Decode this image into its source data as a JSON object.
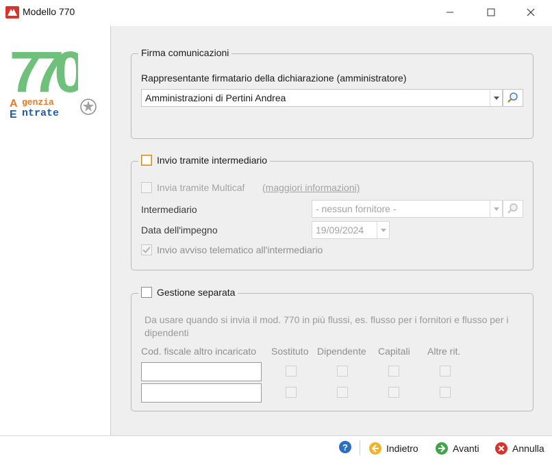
{
  "window": {
    "title": "Modello 770",
    "minimize_icon": "minimize-icon",
    "maximize_icon": "maximize-icon",
    "close_icon": "close-icon"
  },
  "sidebar": {
    "logo_number": "770",
    "agency_line1": "genzia",
    "agency_line2": "ntrate"
  },
  "firma": {
    "legend": "Firma comunicazioni",
    "field_label": "Rappresentante firmatario della dichiarazione (amministratore)",
    "selected_value": "Amministrazioni di Pertini Andrea"
  },
  "intermediario": {
    "legend": "Invio tramite intermediario",
    "checked": false,
    "multicaf_label": "Invia tramite Multicaf",
    "multicaf_link": "(maggiori informazioni)",
    "intermediario_label": "Intermediario",
    "intermediario_value": "- nessun fornitore -",
    "data_label": "Data dell'impegno",
    "data_value": "19/09/2024",
    "avviso_label": "Invio avviso telematico all'intermediario",
    "avviso_checked": true
  },
  "gestione": {
    "legend": "Gestione separata",
    "checked": false,
    "note": "Da usare quando si invia il mod. 770 in più flussi, es. flusso per i fornitori e flusso per i dipendenti",
    "columns": [
      "Cod. fiscale altro incaricato",
      "Sostituto",
      "Dipendente",
      "Capitali",
      "Altre rit."
    ],
    "rows": [
      {
        "cod_fiscale": "",
        "sostituto": false,
        "dipendente": false,
        "capitali": false,
        "altre": false
      },
      {
        "cod_fiscale": "",
        "sostituto": false,
        "dipendente": false,
        "capitali": false,
        "altre": false
      }
    ]
  },
  "footer": {
    "help_icon": "help-icon",
    "back_label": "Indietro",
    "next_label": "Avanti",
    "cancel_label": "Annulla"
  },
  "colors": {
    "logo_green": "#6ec07a",
    "agency_orange": "#e87722",
    "agency_blue": "#1e5aa8",
    "help_blue": "#2c6fc2",
    "nav_yellow": "#f0b429",
    "nav_green": "#3fa548",
    "cancel_red": "#d9342b"
  }
}
